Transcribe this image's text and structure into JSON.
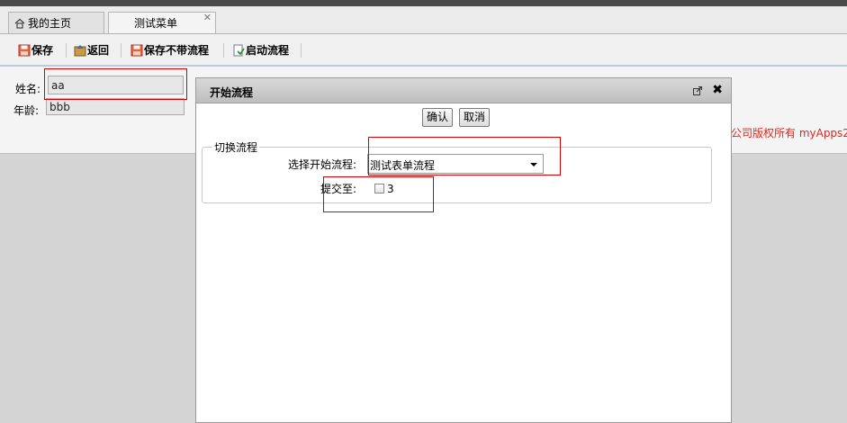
{
  "tabs": {
    "home_label": "我的主页",
    "active_label": "测试菜单",
    "close_glyph": "✕"
  },
  "toolbar": {
    "save": "保存",
    "back": "返回",
    "save_no_flow": "保存不带流程",
    "start_flow": "启动流程"
  },
  "form": {
    "name_label": "姓名:",
    "name_value": "aa",
    "age_label": "年龄:",
    "age_value": "bbb"
  },
  "footer": {
    "copyright": "公司版权所有  myApps2"
  },
  "dialog": {
    "title": "开始流程",
    "confirm_label": "确认",
    "cancel_label": "取消",
    "fieldset_legend": "切换流程",
    "select_flow_label": "选择开始流程:",
    "select_flow_value": "测试表单流程",
    "submit_to_label": "提交至:",
    "submit_option": "3",
    "close_glyph": "✖"
  },
  "colors": {
    "highlight": "#d80000",
    "copyright_text": "#e0261d",
    "toolbar_border": "#b8cde2"
  }
}
